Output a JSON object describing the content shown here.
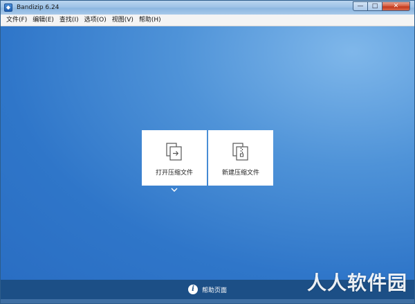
{
  "window": {
    "title": "Bandizip 6.24"
  },
  "title_controls": {
    "minimize": "—",
    "maximize": "□",
    "close": "✕"
  },
  "menu": [
    {
      "label": "文件(F)"
    },
    {
      "label": "编辑(E)"
    },
    {
      "label": "查找(I)"
    },
    {
      "label": "选项(O)"
    },
    {
      "label": "视图(V)"
    },
    {
      "label": "帮助(H)"
    }
  ],
  "cards": {
    "open": {
      "label": "打开压缩文件",
      "icon": "open-archive-icon"
    },
    "new": {
      "label": "新建压缩文件",
      "icon": "new-archive-icon"
    }
  },
  "bottom": {
    "help_label": "帮助页面",
    "help_icon_glyph": "i"
  },
  "watermark": "人人软件园",
  "colors": {
    "main_blue": "#2f76c9",
    "bottom_bar": "#1c4f86"
  }
}
